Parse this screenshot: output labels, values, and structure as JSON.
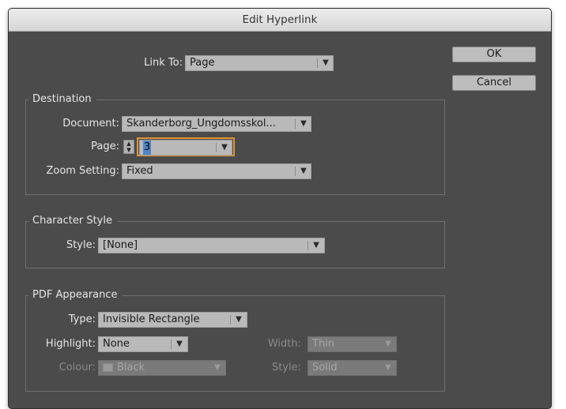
{
  "dialog": {
    "title": "Edit Hyperlink",
    "link_to": {
      "label": "Link To:",
      "value": "Page"
    },
    "buttons": {
      "ok": "OK",
      "cancel": "Cancel"
    },
    "destination": {
      "title": "Destination",
      "document": {
        "label": "Document:",
        "value": "Skanderborg_Ungdomsskol..."
      },
      "page": {
        "label": "Page:",
        "value": "3"
      },
      "zoom": {
        "label": "Zoom Setting:",
        "value": "Fixed"
      }
    },
    "character_style": {
      "title": "Character Style",
      "style": {
        "label": "Style:",
        "value": "[None]"
      }
    },
    "pdf_appearance": {
      "title": "PDF Appearance",
      "type": {
        "label": "Type:",
        "value": "Invisible Rectangle"
      },
      "highlight": {
        "label": "Highlight:",
        "value": "None"
      },
      "width": {
        "label": "Width:",
        "value": "Thin",
        "enabled": false
      },
      "colour": {
        "label": "Colour:",
        "value": "Black",
        "enabled": false
      },
      "style": {
        "label": "Style:",
        "value": "Solid",
        "enabled": false
      }
    }
  },
  "colors": {
    "dialog_bg": "#4b4b4b",
    "field_bg": "#b9b9b9",
    "focus_ring": "#e29233",
    "text": "#e6e6e6",
    "disabled_text": "#8a8a8a"
  }
}
